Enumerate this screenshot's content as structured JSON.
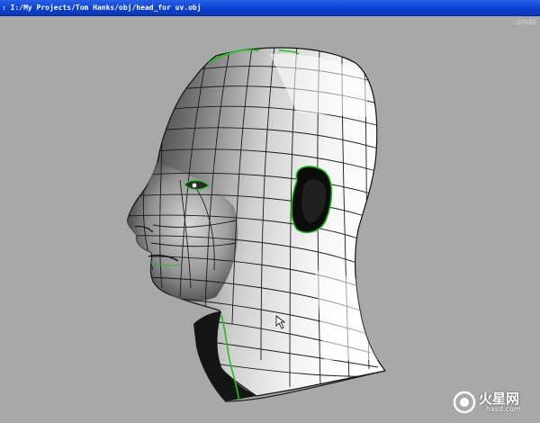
{
  "window": {
    "title_path": ": I:/My Projects/Tom Hanks/obj/head_for uv.obj",
    "undo_label": "undo"
  },
  "viewport": {
    "background": "#a8a8a8",
    "model": "head mesh",
    "seam_color": "#1fc21f",
    "cursor_icon": "mouse-pointer-icon"
  },
  "watermark": {
    "logo_text": "火星网",
    "site": "hxsd.com"
  }
}
